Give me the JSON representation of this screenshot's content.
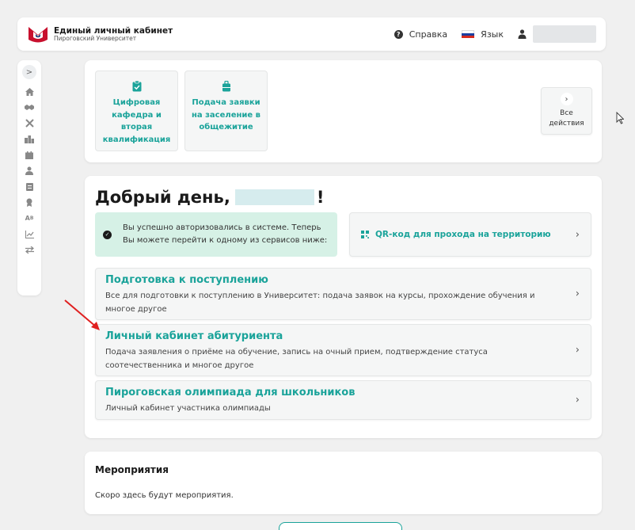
{
  "header": {
    "logo_title": "Единый личный кабинет",
    "logo_subtitle": "Пироговский Университет",
    "help_label": "Справка",
    "language_label": "Язык"
  },
  "sidebar": {
    "toggle": ">",
    "items": [
      "home-icon",
      "handshake-icon",
      "tools-icon",
      "buildings-icon",
      "calendar-icon",
      "person-icon",
      "document-icon",
      "certificate-icon",
      "translate-icon",
      "chart-icon",
      "transfer-icon"
    ]
  },
  "quick_actions": [
    {
      "label": "Цифровая кафедра и вторая квалификация",
      "icon": "clipboard-check-icon"
    },
    {
      "label": "Подача заявки на заселение в общежитие",
      "icon": "suitcase-icon"
    }
  ],
  "all_actions": {
    "label": "Все действия"
  },
  "main": {
    "greeting_prefix": "Добрый день,",
    "greeting_suffix": "!",
    "alert_text": "Вы успешно авторизовались в системе. Теперь Вы можете перейти к одному из сервисов ниже:",
    "qr_label": "QR-код для прохода на территорию",
    "services": [
      {
        "title": "Подготовка к поступлению",
        "desc": "Все для подготовки к поступлению в Университет: подача заявок на курсы, прохождение обучения и многое другое"
      },
      {
        "title": "Личный кабинет абитуриента",
        "desc": "Подача заявления о приёме на обучение, запись на очный прием, подтверждение статуса соотечественника и многое другое"
      },
      {
        "title": "Пироговская олимпиада для школьников",
        "desc": "Личный кабинет участника олимпиады"
      }
    ]
  },
  "events": {
    "title": "Мероприятия",
    "text": "Скоро здесь будут мероприятия."
  },
  "colors": {
    "accent": "#1aa39a",
    "alert_bg": "#d6f1e6",
    "logo_red": "#c8102e",
    "arrow": "#e02020"
  }
}
